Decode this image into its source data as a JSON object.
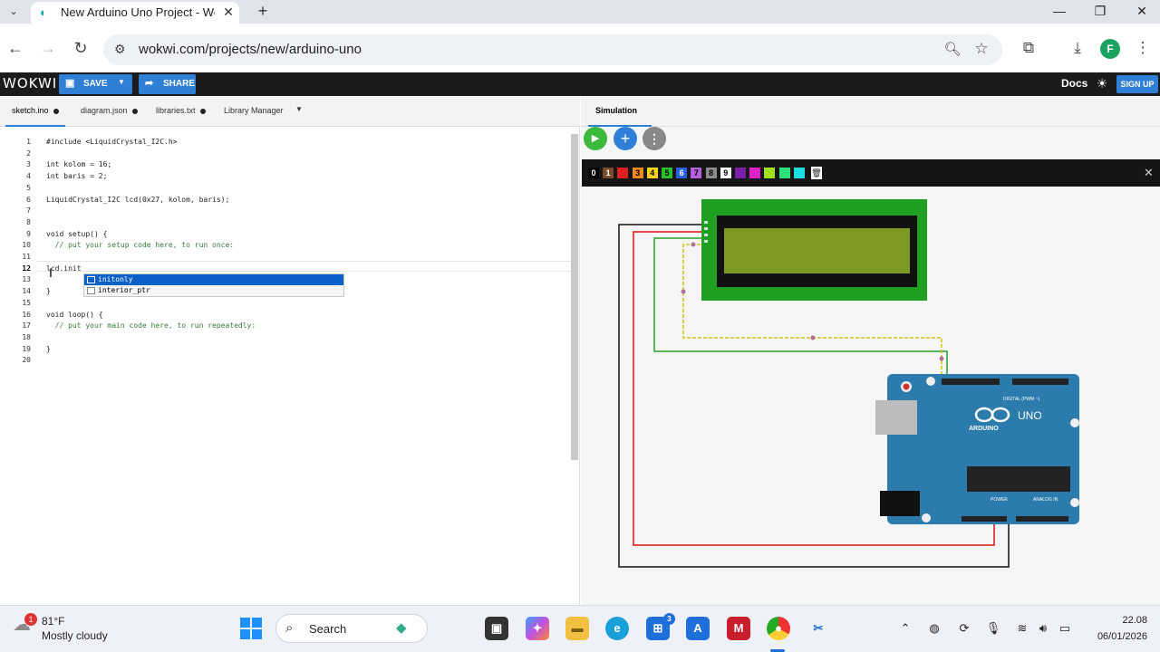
{
  "browser": {
    "tab_title": "New Arduino Uno Project - Wokwi",
    "url": "wokwi.com/projects/new/arduino-uno",
    "profile_initial": "F"
  },
  "header": {
    "logo": "WOKWI",
    "save_label": "SAVE",
    "share_label": "SHARE",
    "docs_label": "Docs",
    "signup_label": "SIGN UP"
  },
  "editor": {
    "tabs": [
      {
        "label": "sketch.ino",
        "modified": true
      },
      {
        "label": "diagram.json",
        "modified": true
      },
      {
        "label": "libraries.txt",
        "modified": true
      },
      {
        "label": "Library Manager",
        "modified": false
      }
    ],
    "current_line": 12,
    "lines": [
      {
        "n": "1",
        "text": "#include <LiquidCrystal_I2C.h>"
      },
      {
        "n": "2",
        "text": ""
      },
      {
        "n": "3",
        "text": "int kolom = 16;"
      },
      {
        "n": "4",
        "text": "int baris = 2;"
      },
      {
        "n": "5",
        "text": ""
      },
      {
        "n": "6",
        "text": "LiquidCrystal_I2C lcd(0x27, kolom, baris);"
      },
      {
        "n": "7",
        "text": ""
      },
      {
        "n": "8",
        "text": ""
      },
      {
        "n": "9",
        "text": "void setup() {"
      },
      {
        "n": "10",
        "text": "  // put your setup code here, to run once:"
      },
      {
        "n": "11",
        "text": ""
      },
      {
        "n": "12",
        "text": "lcd.init"
      },
      {
        "n": "13",
        "text": ""
      },
      {
        "n": "14",
        "text": "}"
      },
      {
        "n": "15",
        "text": ""
      },
      {
        "n": "16",
        "text": "void loop() {"
      },
      {
        "n": "17",
        "text": "  // put your main code here, to run repeatedly:"
      },
      {
        "n": "18",
        "text": ""
      },
      {
        "n": "19",
        "text": "}"
      },
      {
        "n": "20",
        "text": ""
      }
    ],
    "autocomplete": [
      "initonly",
      "interior_ptr"
    ]
  },
  "simulation": {
    "tab_label": "Simulation",
    "palette": [
      {
        "label": "0",
        "color": "#000000",
        "fg": "#ffffff"
      },
      {
        "label": "1",
        "color": "#7a4b2a",
        "fg": "#ffffff"
      },
      {
        "label": "2",
        "color": "#e02020",
        "fg": "#e02020"
      },
      {
        "label": "3",
        "color": "#f08a1c",
        "fg": "#000000"
      },
      {
        "label": "4",
        "color": "#f2d21b",
        "fg": "#000000"
      },
      {
        "label": "5",
        "color": "#2cc12c",
        "fg": "#000000"
      },
      {
        "label": "6",
        "color": "#2660e0",
        "fg": "#ffffff"
      },
      {
        "label": "7",
        "color": "#b45ee0",
        "fg": "#000000"
      },
      {
        "label": "8",
        "color": "#8c8c8c",
        "fg": "#000000"
      },
      {
        "label": "9",
        "color": "#ffffff",
        "fg": "#000000"
      },
      {
        "label": "",
        "color": "#7a1fa8",
        "fg": "#7a1fa8"
      },
      {
        "label": "",
        "color": "#e020c8",
        "fg": "#e020c8"
      },
      {
        "label": "",
        "color": "#a0e01c",
        "fg": "#a0e01c"
      },
      {
        "label": "",
        "color": "#2ce07a",
        "fg": "#2ce07a"
      },
      {
        "label": "",
        "color": "#1ce0e0",
        "fg": "#1ce0e0"
      }
    ],
    "board": {
      "brand": "UNO",
      "maker": "ARDUINO",
      "digital_label": "DIGITAL (PWM ~)",
      "power_label": "POWER",
      "analog_label": "ANALOG IN"
    }
  },
  "taskbar": {
    "weather_badge": "1",
    "weather_temp": "81°F",
    "weather_desc": "Mostly cloudy",
    "search_label": "Search",
    "store_badge": "3",
    "time": "22.08",
    "date": "06/01/2026"
  }
}
